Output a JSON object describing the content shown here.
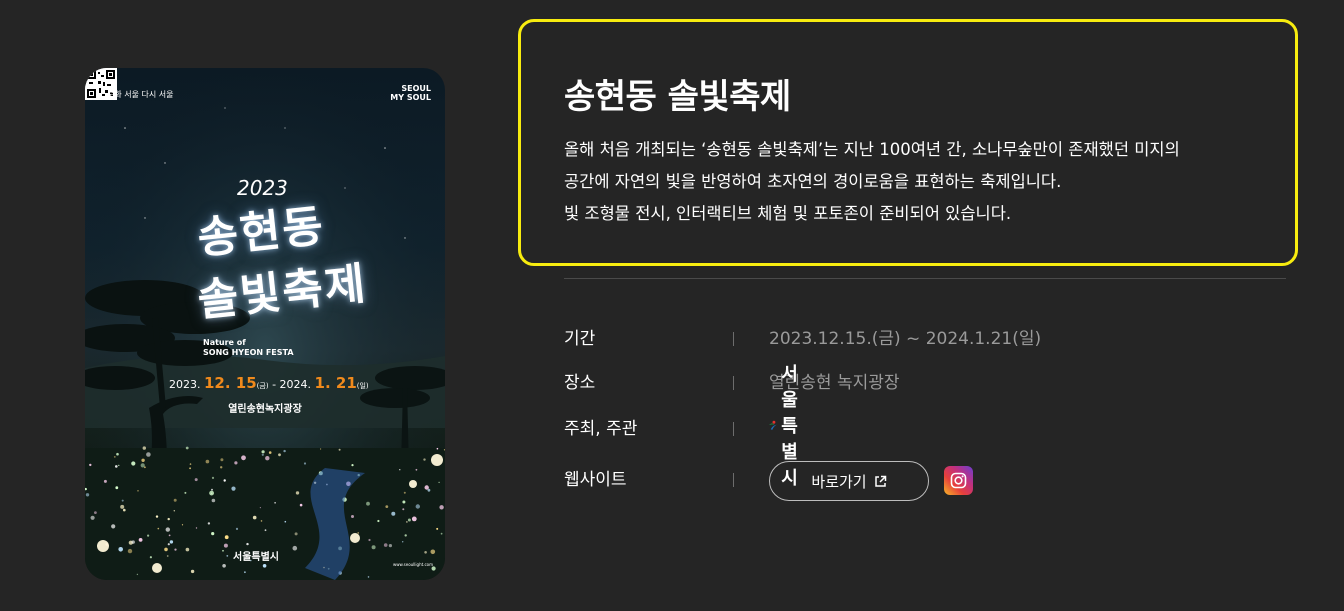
{
  "poster": {
    "top_left_text": "문화 서울\n다시 서울",
    "top_right_text": "SEOUL\nMY SOUL",
    "year": "2023",
    "title_line1": "송현동",
    "title_line2": "솔빛축제",
    "english_line1": "Nature of",
    "english_line2": "SONG HYEON FESTA",
    "dates_prefix": "2023.",
    "dates_start": "12. 15",
    "dates_start_day": "(금)",
    "dates_mid": " - 2024.",
    "dates_end": "1. 21",
    "dates_end_day": "(일)",
    "place": "열린송현녹지광장",
    "seoul_logo": "서울특별시",
    "qr_url": "www.seoullight.com"
  },
  "description": {
    "title": "송현동 솔빛축제",
    "line1": "올해 처음 개최되는 ‘송현동 솔빛축제’는 지난 100여년 간, 소나무숲만이 존재했던 미지의",
    "line2": "공간에 자연의 빛을 반영하여 초자연의 경이로움을 표현하는 축제입니다.",
    "line3": "빛 조형물 전시, 인터랙티브 체험 및 포토존이 준비되어 있습니다."
  },
  "info": {
    "period_label": "기간",
    "period_value": "2023.12.15.(금) ~ 2024.1.21(일)",
    "venue_label": "장소",
    "venue_value": "열린송현 녹지광장",
    "host_label": "주최, 주관",
    "host_value": "서울특별시",
    "website_label": "웹사이트",
    "website_button": "바로가기"
  },
  "icons": {
    "external_link": "external-link-icon",
    "instagram": "instagram-icon",
    "seoul_symbol": "seoul-symbol-icon"
  },
  "colors": {
    "background": "#252525",
    "highlight_border": "#f7ec0f",
    "muted_text": "#9a9a9a",
    "poster_date_accent": "#f08a1c"
  }
}
